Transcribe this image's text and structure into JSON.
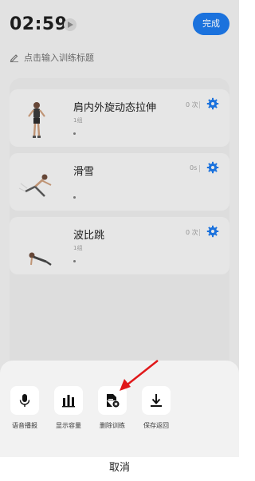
{
  "header": {
    "timer": "02:59",
    "done_label": "完成",
    "title_placeholder": "点击输入训练标题"
  },
  "exercises": [
    {
      "name": "肩内外旋动态拉伸",
      "sub": "1组",
      "value": "0 次"
    },
    {
      "name": "滑雪",
      "sub": "",
      "value": "0s"
    },
    {
      "name": "波比跳",
      "sub": "1组",
      "value": "0 次"
    }
  ],
  "sheet": {
    "actions": [
      {
        "label": "语音播报",
        "icon": "microphone-icon"
      },
      {
        "label": "显示容量",
        "icon": "bar-chart-icon"
      },
      {
        "label": "删除训练",
        "icon": "delete-document-icon"
      },
      {
        "label": "保存返回",
        "icon": "download-icon"
      }
    ],
    "cancel_label": "取消"
  },
  "colors": {
    "accent": "#1d77e6",
    "annotation_arrow": "#e0181a"
  }
}
